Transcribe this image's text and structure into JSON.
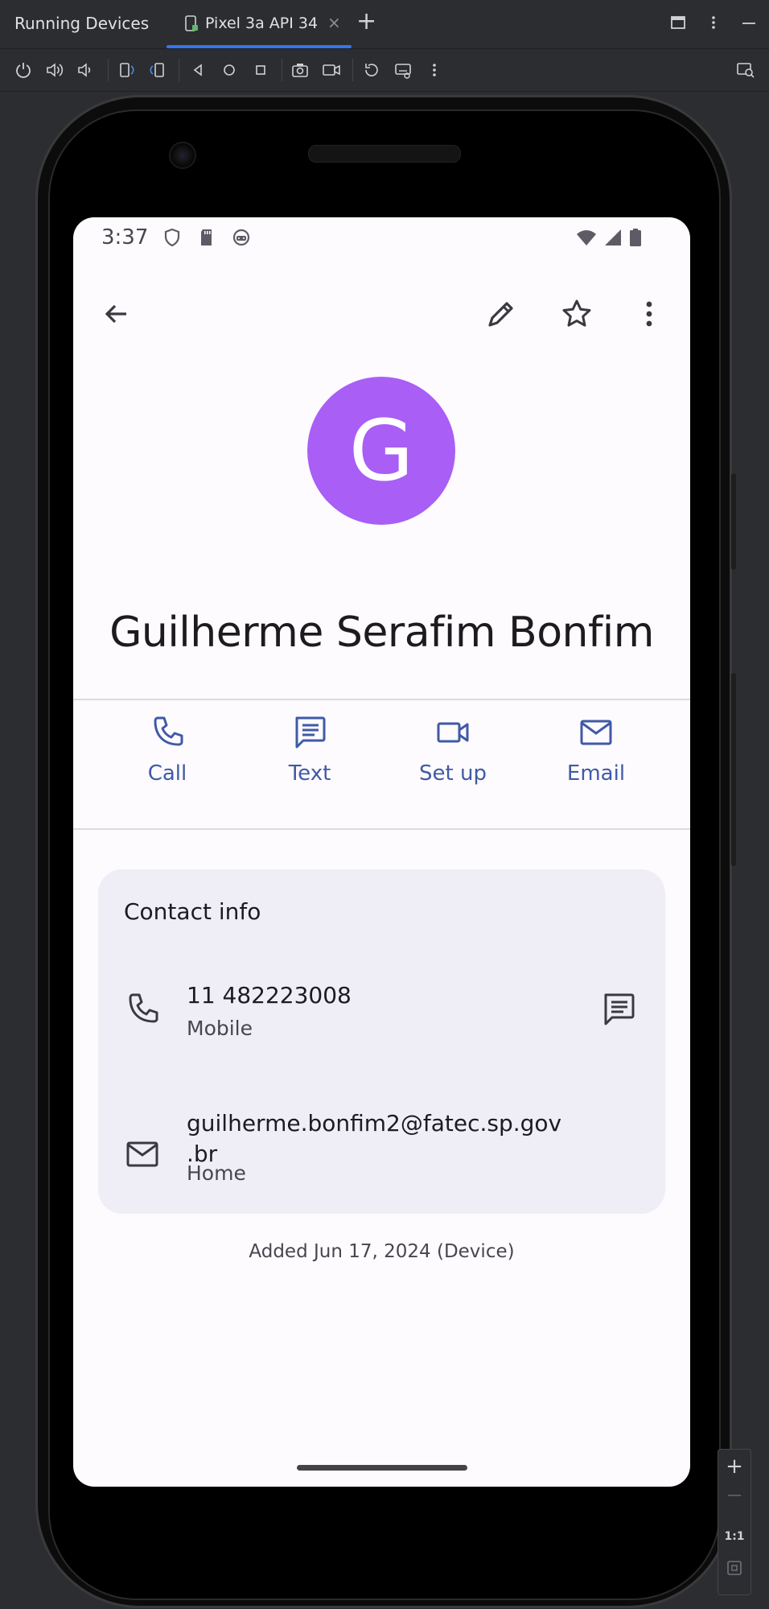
{
  "ide": {
    "panel_title": "Running Devices",
    "device_tab_label": "Pixel 3a API 34",
    "tab_close": "×",
    "add_tab": "+",
    "accent_color": "#3574f0"
  },
  "phone": {
    "status_time": "3:37",
    "contact": {
      "avatar_letter": "G",
      "avatar_color": "#a95ef5",
      "name": "Guilherme Serafim Bonfim"
    },
    "actions": [
      {
        "label": "Call",
        "icon": "phone-icon"
      },
      {
        "label": "Text",
        "icon": "message-icon"
      },
      {
        "label": "Set up",
        "icon": "video-icon"
      },
      {
        "label": "Email",
        "icon": "mail-icon"
      }
    ],
    "contact_info": {
      "title": "Contact info",
      "phone": {
        "value": "11  482223008",
        "type": "Mobile"
      },
      "email": {
        "value_line1": "guilherme.bonfim2@fatec.sp.gov",
        "value_line2": ".br",
        "type": "Home"
      }
    },
    "added_text": "Added Jun 17, 2024 (Device)",
    "action_color": "#3f5aa6"
  },
  "zoom": {
    "plus": "+",
    "minus": "—",
    "one_to_one": "1:1"
  }
}
